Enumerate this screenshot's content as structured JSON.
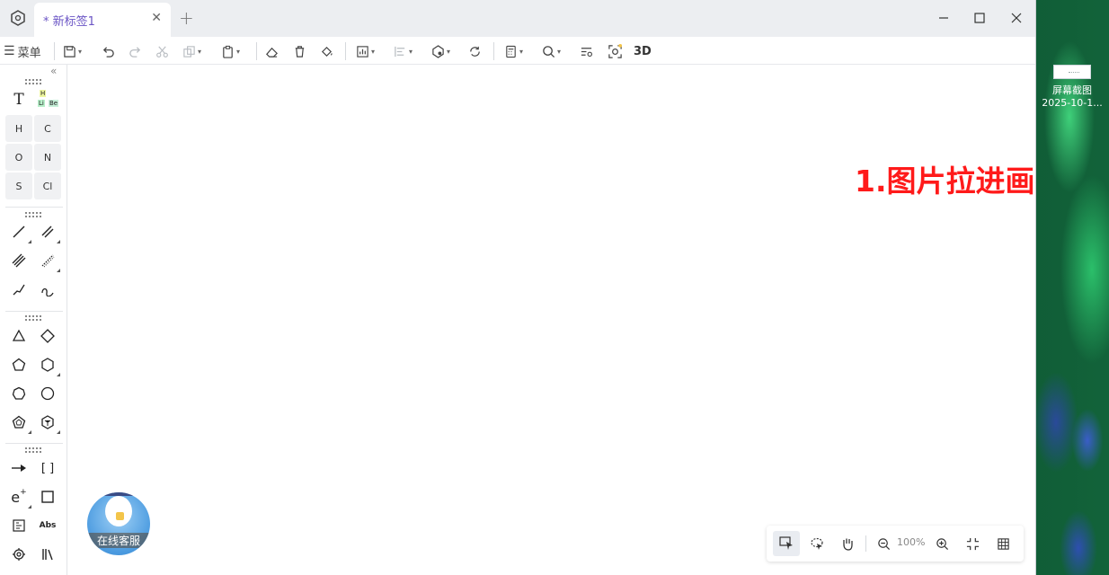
{
  "window": {
    "tab_label": "* 新标签1",
    "controls": {
      "minimize": "—",
      "maximize": "□",
      "close": "✕"
    },
    "add_tab": "+",
    "close_tab": "✕"
  },
  "toolbar": {
    "menu_label": "菜单",
    "label_3d": "3D"
  },
  "canvas": {
    "annotation": "1.图片拉进画布"
  },
  "palette": {
    "text_tool": "T",
    "periodic_table": {
      "h": "H",
      "li": "Li",
      "be": "Be"
    },
    "elements": [
      "H",
      "C",
      "O",
      "N",
      "S",
      "Cl"
    ],
    "brackets": "[ ]",
    "abs": "Abs",
    "electron": "e"
  },
  "mascot": {
    "label": "在线客服"
  },
  "viewbar": {
    "zoom": "100%"
  },
  "desktop": {
    "icon_label_line1": "屏幕截图",
    "icon_label_line2": "2025-10-1..."
  },
  "colors": {
    "accent": "#6b55c5",
    "annotation": "#ff1a1a"
  }
}
